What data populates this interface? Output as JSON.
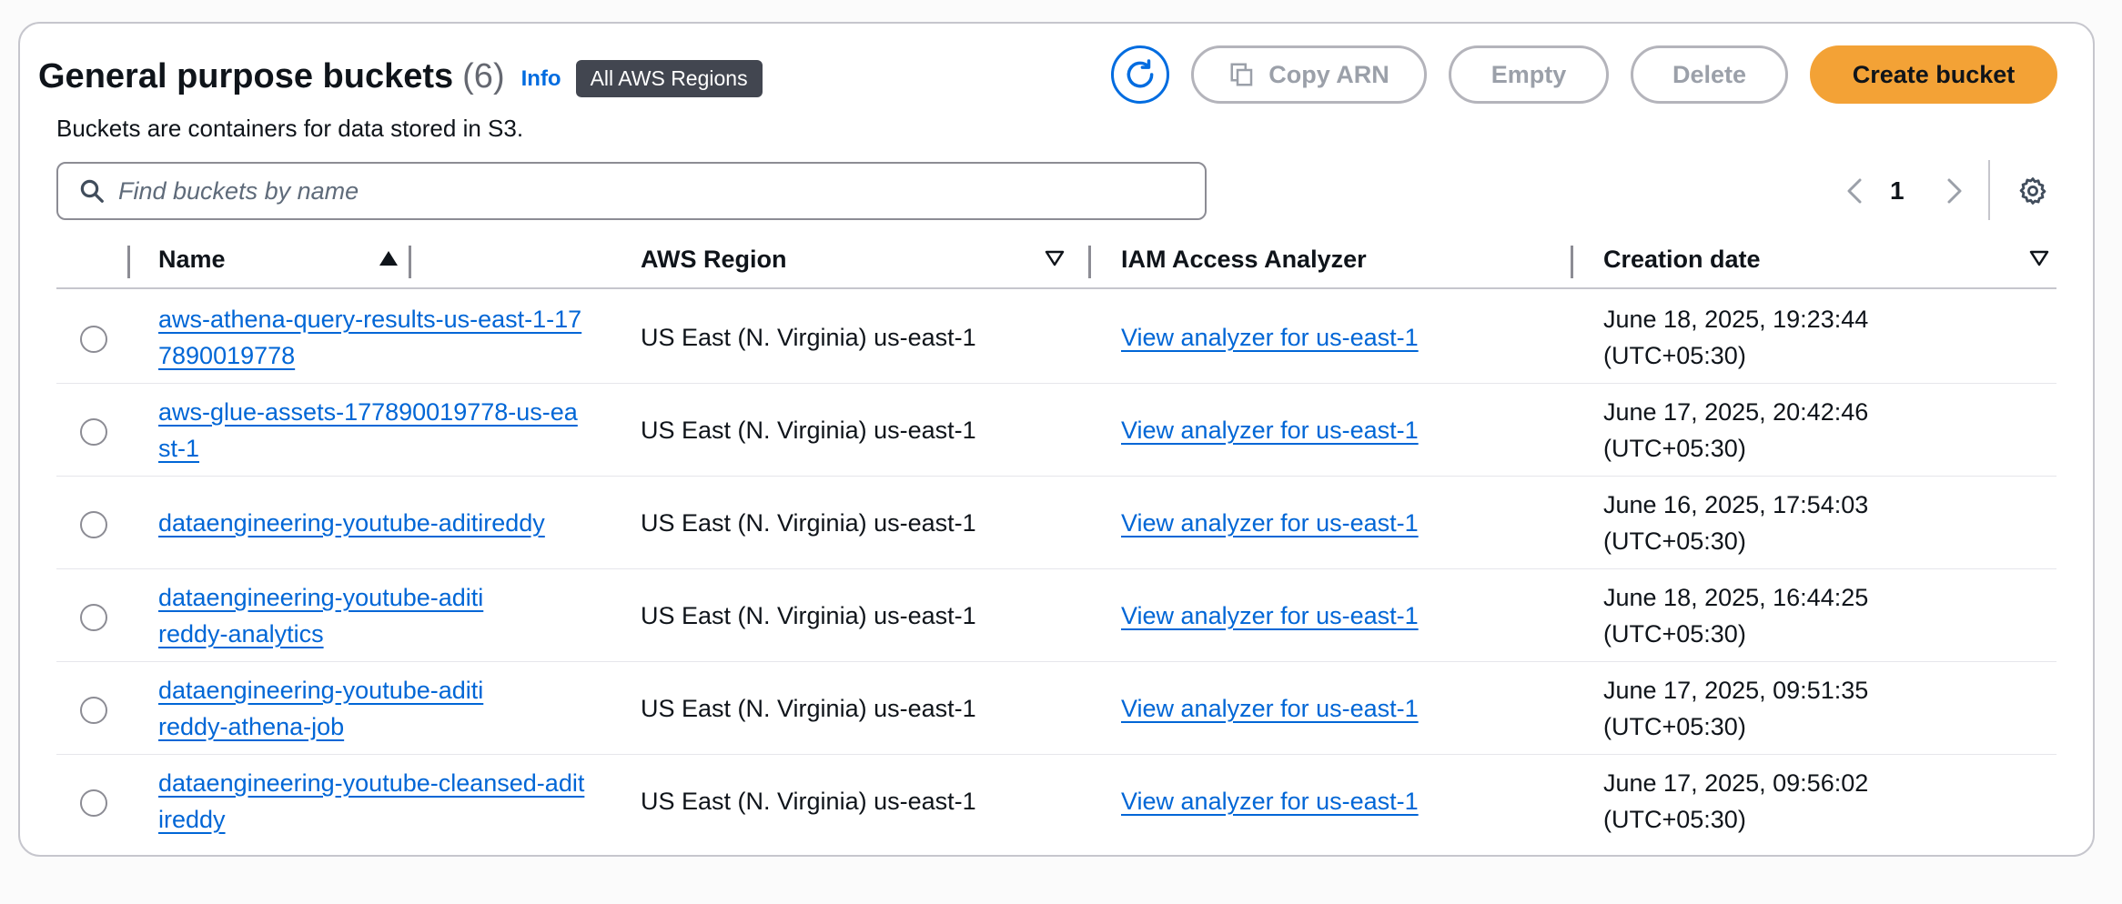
{
  "header": {
    "title": "General purpose buckets",
    "count": "(6)",
    "info_label": "Info",
    "region_badge": "All AWS Regions",
    "description": "Buckets are containers for data stored in S3."
  },
  "toolbar": {
    "refresh_icon": "refresh-icon",
    "copy_arn_label": "Copy ARN",
    "empty_label": "Empty",
    "delete_label": "Delete",
    "create_label": "Create bucket",
    "create_color": "#f3a236",
    "link_color": "#006ce0"
  },
  "search": {
    "placeholder": "Find buckets by name",
    "value": ""
  },
  "pagination": {
    "current_page": "1"
  },
  "table": {
    "columns": {
      "name": "Name",
      "region": "AWS Region",
      "iam": "IAM Access Analyzer",
      "date": "Creation date"
    },
    "rows": [
      {
        "name": "aws-athena-query-results-us-east-1-177890019778",
        "region": "US East (N. Virginia) us-east-1",
        "iam": "View analyzer for us-east-1",
        "date": "June 18, 2025, 19:23:44",
        "tz": "(UTC+05:30)"
      },
      {
        "name": "aws-glue-assets-177890019778-us-east-1",
        "region": "US East (N. Virginia) us-east-1",
        "iam": "View analyzer for us-east-1",
        "date": "June 17, 2025, 20:42:46",
        "tz": "(UTC+05:30)"
      },
      {
        "name": "dataengineering-youtube-aditireddy",
        "region": "US East (N. Virginia) us-east-1",
        "iam": "View analyzer for us-east-1",
        "date": "June 16, 2025, 17:54:03",
        "tz": "(UTC+05:30)"
      },
      {
        "name": "dataengineering-youtube-aditireddy-analytics",
        "region": "US East (N. Virginia) us-east-1",
        "iam": "View analyzer for us-east-1",
        "date": "June 18, 2025, 16:44:25",
        "tz": "(UTC+05:30)"
      },
      {
        "name": "dataengineering-youtube-aditireddy-athena-job",
        "region": "US East (N. Virginia) us-east-1",
        "iam": "View analyzer for us-east-1",
        "date": "June 17, 2025, 09:51:35",
        "tz": "(UTC+05:30)"
      },
      {
        "name": "dataengineering-youtube-cleansed-aditireddy",
        "region": "US East (N. Virginia) us-east-1",
        "iam": "View analyzer for us-east-1",
        "date": "June 17, 2025, 09:56:02",
        "tz": "(UTC+05:30)"
      }
    ]
  }
}
